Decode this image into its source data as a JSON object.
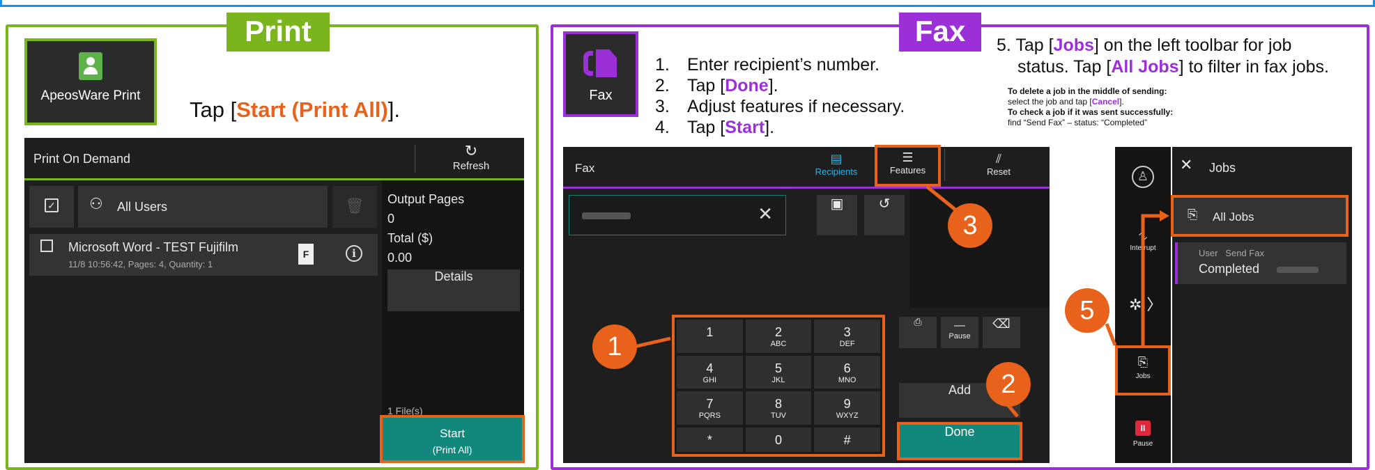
{
  "print": {
    "title": "Print",
    "app_icon_label": "ApeosWare Print",
    "instruction_prefix": "Tap [",
    "instruction_bold": "Start (Print All)",
    "instruction_suffix": "].",
    "screen": {
      "header_title": "Print On Demand",
      "refresh_label": "Refresh",
      "all_users_label": "All Users",
      "job_name": "Microsoft Word - TEST Fujifilm",
      "job_meta": "11/8 10:56:42, Pages: 4, Quantity: 1",
      "file_badge": "F",
      "output_pages_label": "Output Pages",
      "output_pages_value": "0",
      "total_label": "Total ($)",
      "total_value": "0.00",
      "details_label": "Details",
      "files_count": "1 File(s)",
      "start_label": "Start",
      "start_sub_label": "(Print All)"
    }
  },
  "fax": {
    "title": "Fax",
    "app_icon_label": "Fax",
    "steps": [
      {
        "num": "1.",
        "pre": "Enter recipient’s number.",
        "bold": "",
        "post": ""
      },
      {
        "num": "2.",
        "pre": "Tap [",
        "bold": "Done",
        "post": "]."
      },
      {
        "num": "3.",
        "pre": "Adjust features if necessary.",
        "bold": "",
        "post": ""
      },
      {
        "num": "4.",
        "pre": "Tap [",
        "bold": "Start",
        "post": "]."
      }
    ],
    "step5": {
      "line1_pre": "5. Tap [",
      "line1_bold": "Jobs",
      "line1_post": "] on the left toolbar for job",
      "line2_pre": "status. Tap [",
      "line2_bold": "All Jobs",
      "line2_post": "] to filter in fax jobs."
    },
    "notes": {
      "delete_heading": "To delete a job in the middle of sending:",
      "delete_body_pre": "select the job and tap [",
      "delete_body_bold": "Cancel",
      "delete_body_post": "].",
      "check_heading": "To check a job if it was sent successfully:",
      "check_body": "find “Send Fax” – status: “Completed”"
    },
    "screen": {
      "header_title": "Fax",
      "recipients_label": "Recipients",
      "features_label": "Features",
      "reset_label": "Reset",
      "keypad": [
        {
          "digit": "1",
          "letters": ""
        },
        {
          "digit": "2",
          "letters": "ABC"
        },
        {
          "digit": "3",
          "letters": "DEF"
        },
        {
          "digit": "4",
          "letters": "GHI"
        },
        {
          "digit": "5",
          "letters": "JKL"
        },
        {
          "digit": "6",
          "letters": "MNO"
        },
        {
          "digit": "7",
          "letters": "PQRS"
        },
        {
          "digit": "8",
          "letters": "TUV"
        },
        {
          "digit": "9",
          "letters": "WXYZ"
        },
        {
          "digit": "*",
          "letters": ""
        },
        {
          "digit": "0",
          "letters": ""
        },
        {
          "digit": "#",
          "letters": ""
        }
      ],
      "pause_label": "Pause",
      "add_label": "Add",
      "done_label": "Done"
    },
    "jobs_screen": {
      "title": "Jobs",
      "interrupt_label": "Interrupt",
      "jobs_label": "Jobs",
      "pause_label": "Pause",
      "all_jobs_label": "All Jobs",
      "job_user_label": "User",
      "job_type_label": "Send Fax",
      "job_status": "Completed"
    },
    "callouts": [
      "1",
      "2",
      "3",
      "5"
    ]
  },
  "colors": {
    "print_accent": "#7ab51d",
    "fax_accent": "#9b30d9",
    "highlight_orange": "#e8621c",
    "button_teal": "#12877c",
    "top_border_blue": "#1e8fe0"
  }
}
